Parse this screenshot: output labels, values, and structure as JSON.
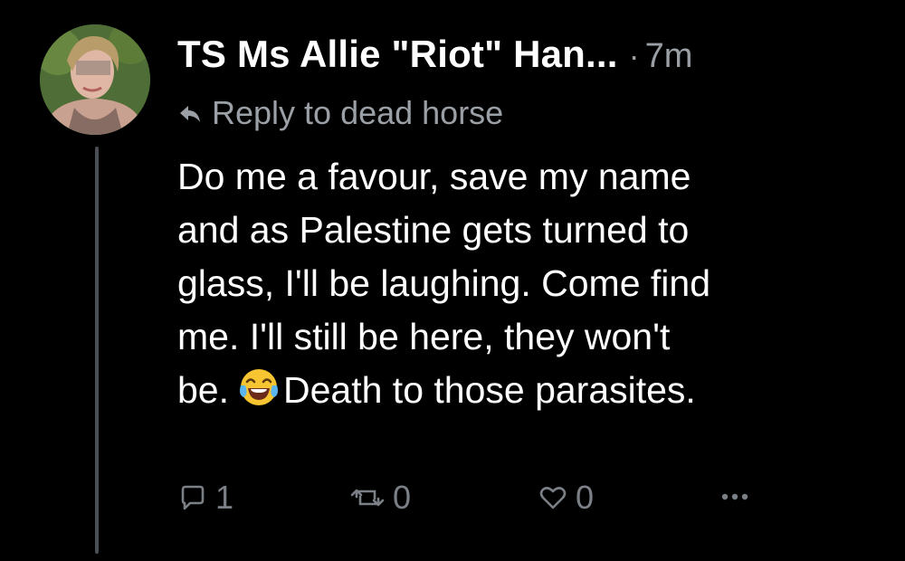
{
  "post": {
    "author": "TS Ms Allie \"Riot\" Han...",
    "separator": "·",
    "time": "7m",
    "reply_to": "Reply to dead horse",
    "body_lines": [
      "Do me a favour, save my name",
      "and as Palestine gets turned to",
      "glass, I'll be laughing. Come find",
      "me. I'll still be here, they won't"
    ],
    "body_last_before_emoji": "be.",
    "body_last_after_emoji": "Death to those parasites.",
    "emoji_icon": "face-with-tears-of-joy-icon",
    "actions": {
      "reply_count": "1",
      "repost_count": "0",
      "like_count": "0"
    }
  },
  "colors": {
    "background": "#000000",
    "text": "#ffffff",
    "muted": "#9aa0a6",
    "action_icons": "#7b8087",
    "thread_line": "#4a4f55"
  }
}
